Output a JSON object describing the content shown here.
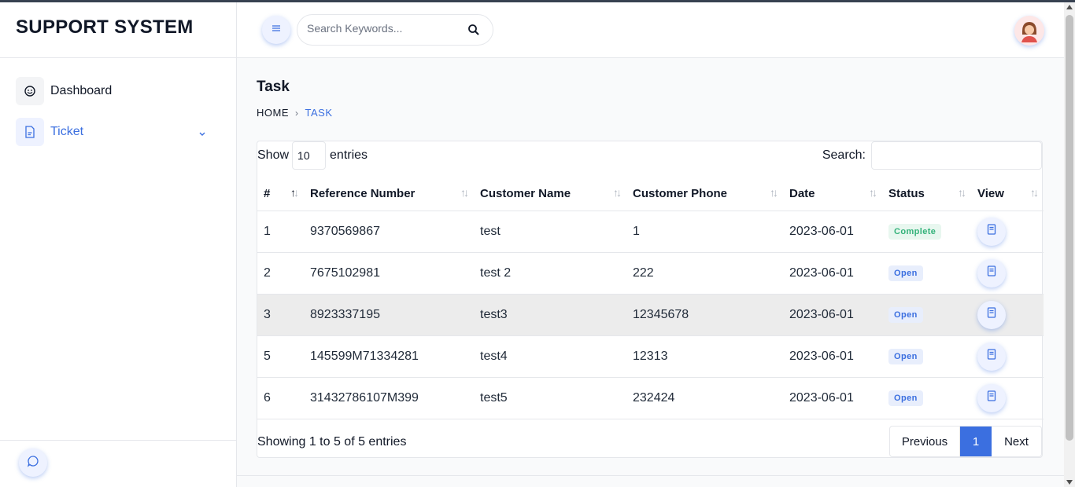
{
  "brand": "SUPPORT SYSTEM",
  "sidebar": {
    "items": [
      {
        "label": "Dashboard",
        "icon": "dashboard-icon"
      },
      {
        "label": "Ticket",
        "icon": "file-icon",
        "active": true
      }
    ]
  },
  "header": {
    "search_placeholder": "Search Keywords..."
  },
  "page": {
    "title": "Task",
    "breadcrumb": {
      "home": "HOME",
      "separator": "›",
      "current": "TASK"
    }
  },
  "table": {
    "length_label_before": "Show",
    "length_value": "10",
    "length_label_after": "entries",
    "search_label": "Search:",
    "columns": [
      "#",
      "Reference Number",
      "Customer Name",
      "Customer Phone",
      "Date",
      "Status",
      "View"
    ],
    "rows": [
      {
        "num": "1",
        "ref": "9370569867",
        "name": "test",
        "phone": "1",
        "date": "2023-06-01",
        "status": "Complete"
      },
      {
        "num": "2",
        "ref": "7675102981",
        "name": "test 2",
        "phone": "222",
        "date": "2023-06-01",
        "status": "Open"
      },
      {
        "num": "3",
        "ref": "8923337195",
        "name": "test3",
        "phone": "12345678",
        "date": "2023-06-01",
        "status": "Open"
      },
      {
        "num": "5",
        "ref": "145599M71334281",
        "name": "test4",
        "phone": "12313",
        "date": "2023-06-01",
        "status": "Open"
      },
      {
        "num": "6",
        "ref": "31432786107M399",
        "name": "test5",
        "phone": "232424",
        "date": "2023-06-01",
        "status": "Open"
      }
    ],
    "info": "Showing 1 to 5 of 5 entries",
    "pagination": {
      "previous": "Previous",
      "page": "1",
      "next": "Next"
    }
  },
  "colors": {
    "accent": "#3b6fe0",
    "complete": "#34b27a",
    "open": "#3b6fe0",
    "highlight_row": "#ececec"
  }
}
